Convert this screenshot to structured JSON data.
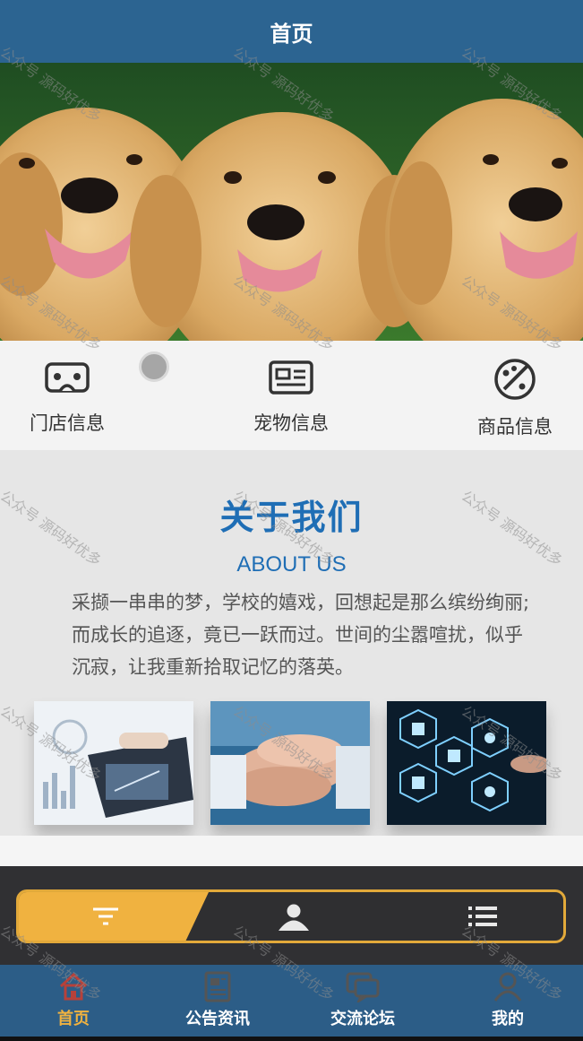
{
  "page": {
    "title": "首页"
  },
  "banner": {
    "image": "three golden retriever puppies photo"
  },
  "quick_nav": [
    {
      "label": "门店信息",
      "icon": "vr-headset-icon"
    },
    {
      "label": "宠物信息",
      "icon": "id-card-icon"
    },
    {
      "label": "商品信息",
      "icon": "palette-icon"
    }
  ],
  "about": {
    "title": "关于我们",
    "subtitle": "ABOUT US",
    "body": "采撷一串串的梦，学校的嬉戏，回想起是那么缤纷绚丽;而成长的追逐，竟已一跃而过。世间的尘嚣喧扰，似乎沉寂，让我重新拾取记忆的落英。",
    "images": [
      "business-analytics-photo",
      "team-hands-photo",
      "tech-hexagon-icons-photo"
    ]
  },
  "segment_tabs": [
    {
      "icon": "filter-icon",
      "active": true
    },
    {
      "icon": "user-icon",
      "active": false
    },
    {
      "icon": "list-icon",
      "active": false
    }
  ],
  "tab_bar": [
    {
      "label": "首页",
      "icon": "home-icon",
      "active": true
    },
    {
      "label": "公告资讯",
      "icon": "news-icon",
      "active": false
    },
    {
      "label": "交流论坛",
      "icon": "chat-icon",
      "active": false
    },
    {
      "label": "我的",
      "icon": "profile-icon",
      "active": false
    }
  ],
  "watermark": "公众号 源码好优多",
  "colors": {
    "header": "#2c6491",
    "accent": "#1f6eb5",
    "gold": "#f0b240",
    "tabbar": "#2c5d87"
  }
}
